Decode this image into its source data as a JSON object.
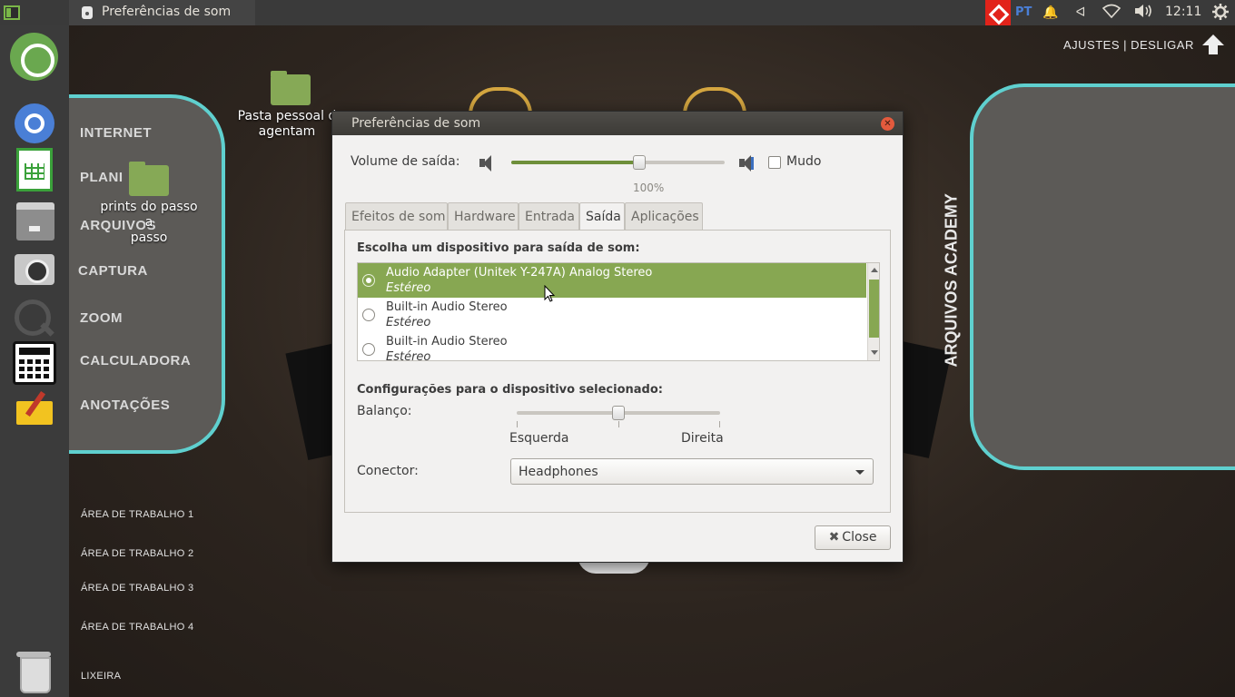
{
  "top_panel": {
    "window_title": "Preferências de som",
    "lang": "PT",
    "clock": "12:11"
  },
  "launcher": {
    "items": [
      "ubuntu-icon",
      "chrome-icon",
      "spreadsheet-icon",
      "files-icon",
      "camera-icon",
      "zoom-icon",
      "calculator-icon",
      "notes-icon",
      "trash-icon"
    ]
  },
  "desktop": {
    "left_panel": [
      "INTERNET",
      "PLANI",
      "ARQUIVOS",
      "CAPTURA",
      "ZOOM",
      "CALCULADORA",
      "ANOTAÇÕES"
    ],
    "right_panel_title": "ARQUIVOS ACADEMY",
    "settings_link": "AJUSTES | DESLIGAR",
    "workspaces": [
      "ÁREA DE TRABALHO 1",
      "ÁREA DE TRABALHO 2",
      "ÁREA DE TRABALHO 3",
      "ÁREA DE TRABALHO 4"
    ],
    "trash_label": "LIXEIRA",
    "folder_home_label_1": "Pasta pessoal d",
    "folder_home_label_2": "agentam",
    "folder_prints_label_1": "prints do passo a",
    "folder_prints_label_2": "passo"
  },
  "dialog": {
    "title": "Preferências de som",
    "volume_label": "Volume de saída:",
    "volume_value": "100%",
    "volume_fraction": 0.6,
    "mute_label": "Mudo",
    "mute_checked": false,
    "tabs": [
      "Efeitos de som",
      "Hardware",
      "Entrada",
      "Saída",
      "Aplicações"
    ],
    "active_tab": "Saída",
    "device_heading": "Escolha um dispositivo para saída de som:",
    "devices": [
      {
        "name": "Audio Adapter (Unitek Y-247A) Analog Stereo",
        "profile": "Estéreo",
        "selected": true
      },
      {
        "name": "Built-in Audio Stereo",
        "profile": "Estéreo",
        "selected": false
      },
      {
        "name": "Built-in Audio Stereo",
        "profile": "Estéreo",
        "selected": false
      }
    ],
    "settings_heading": "Configurações para o dispositivo selecionado:",
    "balance_label": "Balanço:",
    "balance_left": "Esquerda",
    "balance_right": "Direita",
    "balance_fraction": 0.5,
    "connector_label": "Conector:",
    "connector_value": "Headphones",
    "close_label": "Close"
  }
}
